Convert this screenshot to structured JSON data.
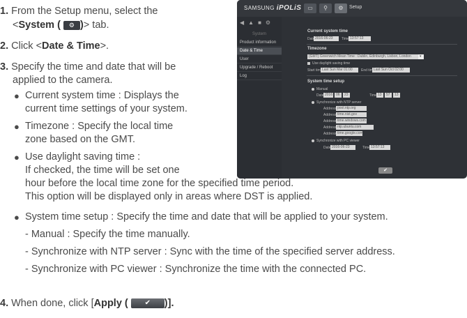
{
  "steps": [
    {
      "num": "1.",
      "pre": "From the Setup menu, select the",
      "pre2": "<",
      "bold": "System (",
      "bold2": ")",
      "post": "> tab.",
      "icon": "gear-icon"
    },
    {
      "num": "2.",
      "pre": "Click <",
      "bold": "Date & Time",
      "post": ">."
    },
    {
      "num": "3.",
      "line1": "Specify the time and date that will be",
      "line2": "applied to the camera."
    },
    {
      "num": "4.",
      "pre": "When done, click [",
      "bold": "Apply (",
      "post": ")]."
    }
  ],
  "bullets": [
    {
      "l1": "Current system time : Displays the",
      "l2": "current time settings of your system."
    },
    {
      "l1": "Timezone : Specify the local time",
      "l2": "zone based on the GMT."
    },
    {
      "l1": "Use daylight saving time :",
      "l2": "If checked, the time will be set one",
      "l3": "hour before the local time zone for the specified time period.",
      "l4": "This option will be displayed only in areas where DST is applied."
    },
    {
      "l1": "System time setup : Specify the time and date that will be applied to your system."
    }
  ],
  "subs": [
    "- Manual : Specify the time manually.",
    "- Synchronize with NTP server : Sync with the time of the specified server address.",
    "- Synchronize with PC viewer : Synchronize the time with the connected PC."
  ],
  "shot": {
    "brand_small": "SAMSUNG",
    "brand_big": "iPOLiS",
    "setup": "Setup",
    "side_header": "System",
    "side_items": [
      "Product information",
      "Date & Time",
      "User",
      "Upgrade / Reboot",
      "Log"
    ],
    "current_time_title": "Current system time",
    "date_label": "Date",
    "date_val": "2016-06-23",
    "time_label": "Time",
    "time_val": "13:57:13",
    "timezone_title": "Timezone",
    "timezone_val": "(GMT) Greenwich Mean Time : Dublin, Edinburgh, Lisbon, London",
    "dst_label": "Use daylight saving time",
    "start_label": "Start time",
    "start_val": "Last Sun Mar 01:00",
    "end_label": "End time",
    "end_val": "Last Sun Oct 02:00",
    "setup_title": "System time setup",
    "manual": "Manual",
    "m_date": "Date",
    "m_date_vals": [
      "2016",
      "06",
      "23"
    ],
    "m_time": "Time",
    "m_time_vals": [
      "13",
      "57",
      "13"
    ],
    "ntp": "Synchronize with NTP server",
    "addr_label": "Address",
    "addresses": [
      "pool.ntp.org",
      "time.nist.gov",
      "time.windows.com",
      "ntp.ubuntu.com",
      "time.google.com"
    ],
    "pc": "Synchronize with PC viewer",
    "pc_date": "Date",
    "pc_date_val": "2016-06-23",
    "pc_time": "Time",
    "pc_time_val": "13:57:13",
    "ok": "✔"
  }
}
